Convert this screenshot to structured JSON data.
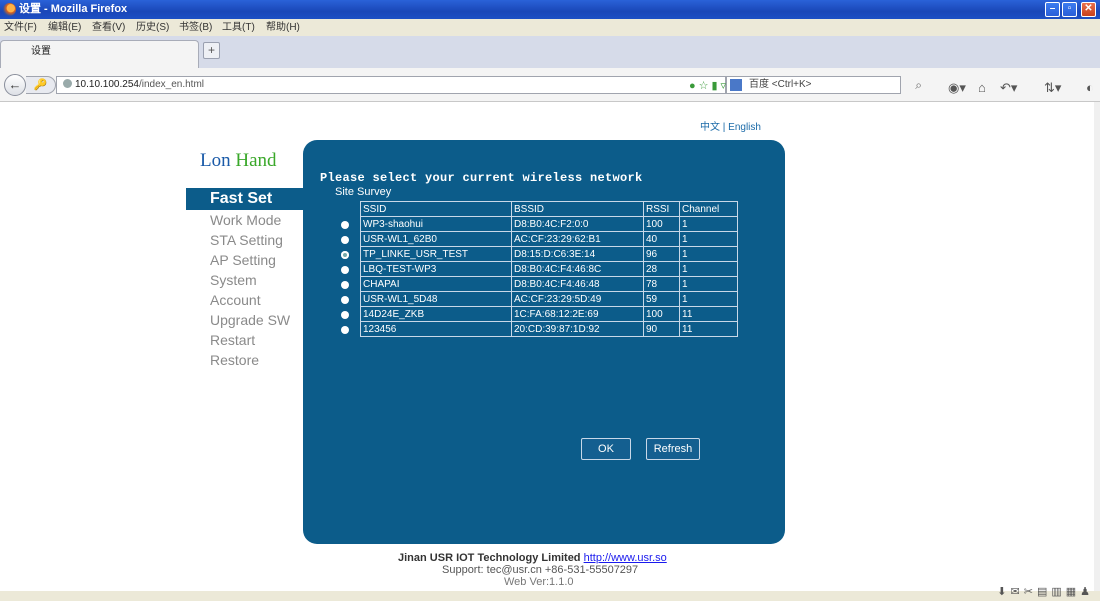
{
  "window": {
    "title": "设置 - Mozilla Firefox",
    "controls": [
      "minimize",
      "maximize",
      "close"
    ]
  },
  "menu": [
    "文件(F)",
    "编辑(E)",
    "查看(V)",
    "历史(S)",
    "书签(B)",
    "工具(T)",
    "帮助(H)"
  ],
  "tab": {
    "label": "设置",
    "new_tab_label": "+"
  },
  "nav": {
    "url_host": "10.10.100.254",
    "url_path": "/index_en.html",
    "search_placeholder": "百度 <Ctrl+K>"
  },
  "page": {
    "language_switch": "中文 | English",
    "logo_lon": "Lon",
    "logo_hand": "Hand",
    "sidebar": {
      "active": "Fast Set",
      "items": [
        "Work Mode",
        "STA Setting",
        "AP Setting",
        "System",
        "Account",
        "Upgrade SW",
        "Restart",
        "Restore"
      ]
    },
    "panel": {
      "title": "Please select your current wireless network",
      "subtitle": "Site Survey",
      "columns": [
        "SSID",
        "BSSID",
        "RSSI",
        "Channel"
      ],
      "rows": [
        {
          "ssid": "WP3-shaohui",
          "bssid": "D8:B0:4C:F2:0:0",
          "rssi": "100",
          "channel": "1",
          "selected": false
        },
        {
          "ssid": "USR-WL1_62B0",
          "bssid": "AC:CF:23:29:62:B1",
          "rssi": "40",
          "channel": "1",
          "selected": false
        },
        {
          "ssid": "TP_LINKE_USR_TEST",
          "bssid": "D8:15:D:C6:3E:14",
          "rssi": "96",
          "channel": "1",
          "selected": true
        },
        {
          "ssid": "LBQ-TEST-WP3",
          "bssid": "D8:B0:4C:F4:46:8C",
          "rssi": "28",
          "channel": "1",
          "selected": false
        },
        {
          "ssid": "CHAPAI",
          "bssid": "D8:B0:4C:F4:46:48",
          "rssi": "78",
          "channel": "1",
          "selected": false
        },
        {
          "ssid": "USR-WL1_5D48",
          "bssid": "AC:CF:23:29:5D:49",
          "rssi": "59",
          "channel": "1",
          "selected": false
        },
        {
          "ssid": "14D24E_ZKB",
          "bssid": "1C:FA:68:12:2E:69",
          "rssi": "100",
          "channel": "11",
          "selected": false
        },
        {
          "ssid": "123456",
          "bssid": "20:CD:39:87:1D:92",
          "rssi": "90",
          "channel": "11",
          "selected": false
        }
      ],
      "ok_label": "OK",
      "refresh_label": "Refresh"
    },
    "footer": {
      "company": "Jinan USR IOT Technology Limited",
      "link": "http://www.usr.so",
      "support": "Support: tec@usr.cn +86-531-55507297",
      "version": "Web Ver:1.1.0"
    }
  }
}
